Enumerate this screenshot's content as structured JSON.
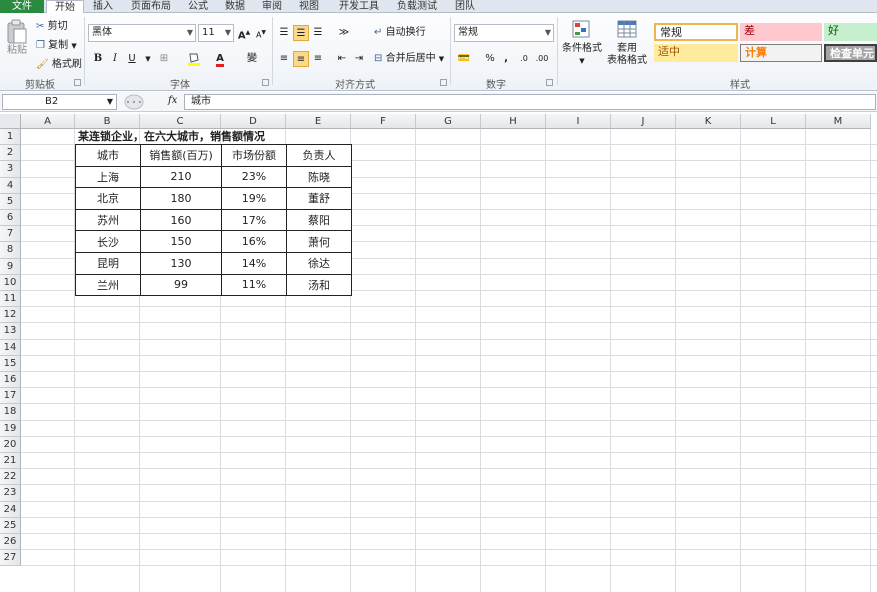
{
  "tabs": [
    "文件",
    "开始",
    "插入",
    "页面布局",
    "公式",
    "数据",
    "审阅",
    "视图",
    "开发工具",
    "负载测试",
    "团队"
  ],
  "clipboard": {
    "paste": "粘贴",
    "cut": "剪切",
    "copy": "复制",
    "format_painter": "格式刷",
    "label": "剪贴板"
  },
  "font": {
    "name": "黑体",
    "size": "11",
    "label": "字体",
    "bold": "B",
    "italic": "I",
    "underline": "U",
    "grow": "A",
    "shrink": "A",
    "phonetic": "變"
  },
  "alignment": {
    "wrap_text": "自动换行",
    "merge_center": "合并后居中",
    "label": "对齐方式"
  },
  "number": {
    "format": "常规",
    "label": "数字",
    "percent": "%",
    "comma": ","
  },
  "styles": {
    "conditional_format": "条件格式",
    "table_format_1": "套用",
    "table_format_2": "表格格式",
    "normal": "常规",
    "bad": "差",
    "good": "好",
    "neutral": "适中",
    "calculation": "计算",
    "check_cell": "检查单元",
    "label": "样式",
    "colors": {
      "bad_bg": "#ffc7ce",
      "bad_fg": "#9c0006",
      "good_bg": "#c6efce",
      "good_fg": "#006100",
      "neutral_bg": "#ffeb9c",
      "neutral_fg": "#9c5700",
      "calc_bg": "#f2f2f2",
      "calc_fg": "#fa7d00",
      "check_bg": "#a5a5a5",
      "check_fg": "#ffffff"
    }
  },
  "formula_bar": {
    "cell_ref": "B2",
    "fx": "fx",
    "content": "城市"
  },
  "columns": [
    "A",
    "B",
    "C",
    "D",
    "E",
    "F",
    "G",
    "H",
    "I",
    "J",
    "K",
    "L",
    "M"
  ],
  "rows": [
    "1",
    "2",
    "3",
    "4",
    "5",
    "6",
    "7",
    "8",
    "9",
    "10",
    "11",
    "12",
    "13",
    "14",
    "15",
    "16",
    "17",
    "18",
    "19",
    "20",
    "21",
    "22",
    "23",
    "24",
    "25",
    "26",
    "27"
  ],
  "sheet": {
    "title": "某连锁企业，在六大城市，销售额情况",
    "headers": [
      "城市",
      "销售额(百万)",
      "市场份额",
      "负责人"
    ],
    "rows": [
      [
        "上海",
        "210",
        "23%",
        "陈晓"
      ],
      [
        "北京",
        "180",
        "19%",
        "董舒"
      ],
      [
        "苏州",
        "160",
        "17%",
        "蔡阳"
      ],
      [
        "长沙",
        "150",
        "16%",
        "萧何"
      ],
      [
        "昆明",
        "130",
        "14%",
        "徐达"
      ],
      [
        "兰州",
        "99",
        "11%",
        "汤和"
      ]
    ]
  }
}
